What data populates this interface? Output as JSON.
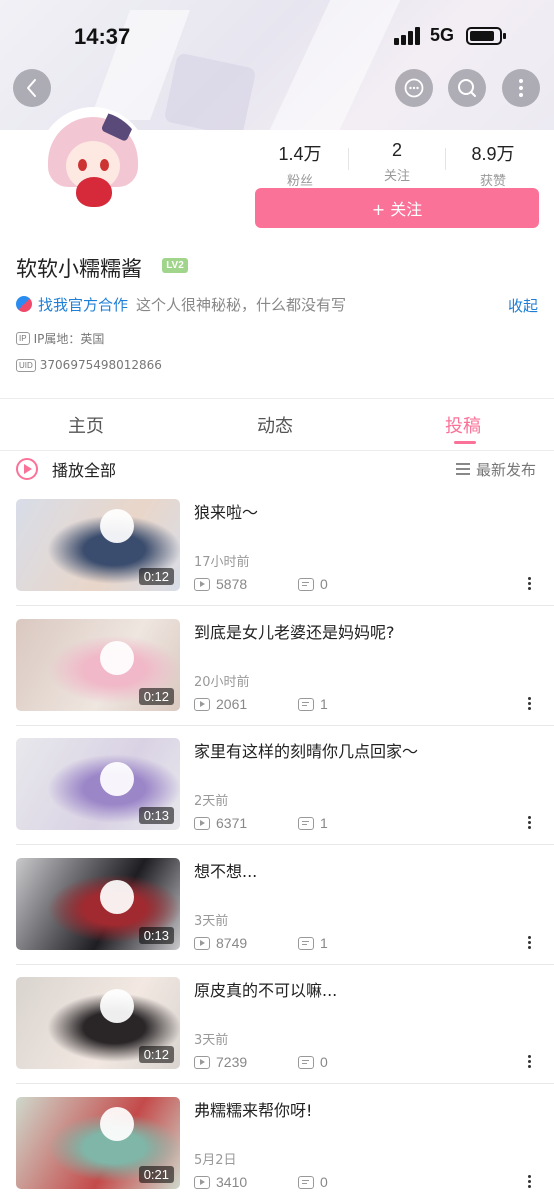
{
  "status_bar": {
    "time": "14:37",
    "network": "5G"
  },
  "profile": {
    "username": "软软小糯糯酱",
    "level": "LV2",
    "stats": [
      {
        "value": "1.4万",
        "label": "粉丝"
      },
      {
        "value": "2",
        "label": "关注"
      },
      {
        "value": "8.9万",
        "label": "获赞"
      }
    ],
    "follow_label": "+ 关注",
    "business_link": "找我官方合作",
    "bio": "这个人很神秘秘，什么都没有写",
    "collapse_label": "收起",
    "ip_tag": "IP",
    "ip_text": "IP属地：英国",
    "uid_tag": "UID",
    "uid": "3706975498012866"
  },
  "tabs": [
    {
      "label": "主页",
      "active": false
    },
    {
      "label": "动态",
      "active": false
    },
    {
      "label": "投稿",
      "active": true
    }
  ],
  "list_header": {
    "play_all": "播放全部",
    "sort": "最新发布"
  },
  "videos": [
    {
      "title": "狼来啦～",
      "time": "17小时前",
      "views": "5878",
      "danmaku": "0",
      "duration": "0:12",
      "colors": [
        "#d8dde8",
        "#3b4d6e",
        "#e9d6c9"
      ]
    },
    {
      "title": "到底是女儿老婆还是妈妈呢?",
      "time": "20小时前",
      "views": "2061",
      "danmaku": "1",
      "duration": "0:12",
      "colors": [
        "#d9c8c0",
        "#f0b8c8",
        "#efe6e0"
      ]
    },
    {
      "title": "家里有这样的刻晴你几点回家～",
      "time": "2天前",
      "views": "6371",
      "danmaku": "1",
      "duration": "0:13",
      "colors": [
        "#e8e8ec",
        "#9b86c8",
        "#d9d2e4"
      ]
    },
    {
      "title": "想不想...",
      "time": "3天前",
      "views": "8749",
      "danmaku": "1",
      "duration": "0:13",
      "colors": [
        "#c9c9cc",
        "#a12a30",
        "#1d1d22"
      ]
    },
    {
      "title": "原皮真的不可以嘛...",
      "time": "3天前",
      "views": "7239",
      "danmaku": "0",
      "duration": "0:12",
      "colors": [
        "#d9d4cf",
        "#2a2628",
        "#f3e8e2"
      ]
    },
    {
      "title": "弗糯糯来帮你呀!",
      "time": "5月2日",
      "views": "3410",
      "danmaku": "0",
      "duration": "0:21",
      "colors": [
        "#cfd8cc",
        "#7fb6a8",
        "#c44a4a"
      ]
    }
  ],
  "accent_color": "#fb7299",
  "link_color": "#1e7fd6"
}
